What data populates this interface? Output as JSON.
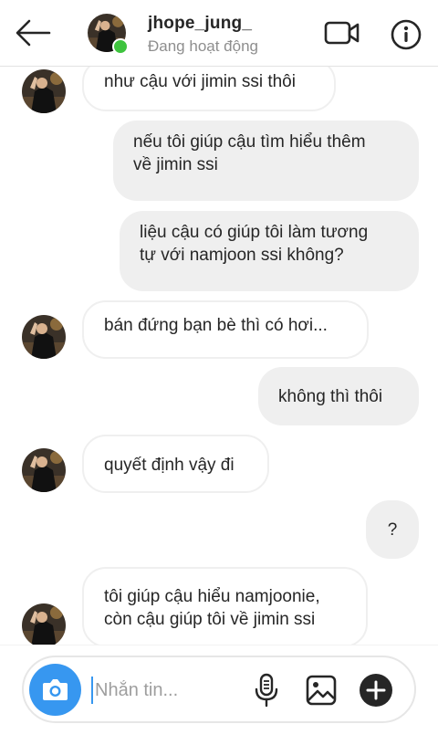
{
  "header": {
    "username": "jhope_jung_",
    "status": "Đang hoạt động"
  },
  "messages": [
    {
      "side": "incoming",
      "lines": [
        "như cậu với jimin ssi thôi"
      ]
    },
    {
      "side": "outgoing",
      "lines": [
        "nếu tôi giúp cậu tìm hiểu thêm",
        "về jimin ssi"
      ]
    },
    {
      "side": "outgoing",
      "lines": [
        "liệu cậu có giúp tôi làm tương",
        "tự với namjoon ssi không?"
      ]
    },
    {
      "side": "incoming",
      "lines": [
        "bán đứng bạn bè thì có hơi..."
      ]
    },
    {
      "side": "outgoing",
      "lines": [
        "không thì thôi"
      ]
    },
    {
      "side": "incoming",
      "lines": [
        "quyết định vậy đi"
      ]
    },
    {
      "side": "outgoing",
      "lines": [
        "?"
      ]
    },
    {
      "side": "incoming",
      "lines": [
        "tôi giúp cậu hiểu namjoonie,",
        "còn cậu giúp tôi về jimin ssi"
      ]
    }
  ],
  "composer": {
    "placeholder": "Nhắn tin..."
  },
  "icons": {
    "back": "arrow-left-icon",
    "video": "video-camera-icon",
    "info": "info-icon",
    "camera": "camera-icon",
    "mic": "microphone-icon",
    "gallery": "image-icon",
    "plus": "plus-icon"
  },
  "colors": {
    "accent": "#3797f0",
    "online": "#3ec33e",
    "outgoing_bubble": "#efefef",
    "status_text": "#8e8e8e"
  }
}
